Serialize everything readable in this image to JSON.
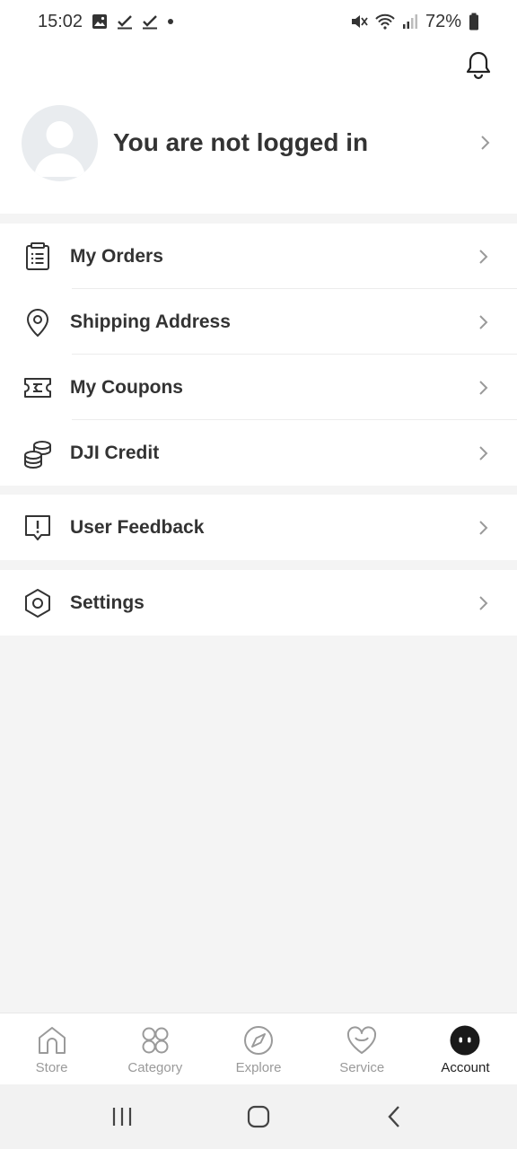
{
  "status_bar": {
    "time": "15:02",
    "battery": "72%"
  },
  "profile": {
    "title": "You are not logged in"
  },
  "menu_groups": [
    [
      {
        "label": "My Orders",
        "icon": "orders-icon"
      },
      {
        "label": "Shipping Address",
        "icon": "location-pin-icon"
      },
      {
        "label": "My Coupons",
        "icon": "coupon-icon"
      },
      {
        "label": "DJI Credit",
        "icon": "coins-icon"
      }
    ],
    [
      {
        "label": "User Feedback",
        "icon": "feedback-icon"
      }
    ],
    [
      {
        "label": "Settings",
        "icon": "settings-icon"
      }
    ]
  ],
  "bottom_nav": {
    "tabs": [
      {
        "label": "Store",
        "icon": "home-icon",
        "active": false
      },
      {
        "label": "Category",
        "icon": "category-icon",
        "active": false
      },
      {
        "label": "Explore",
        "icon": "compass-icon",
        "active": false
      },
      {
        "label": "Service",
        "icon": "heart-smile-icon",
        "active": false
      },
      {
        "label": "Account",
        "icon": "account-face-icon",
        "active": true
      }
    ]
  },
  "colors": {
    "background": "#f4f4f4",
    "text": "#333333",
    "inactive": "#9a9a9a",
    "active_icon": "#1a1a1a"
  }
}
